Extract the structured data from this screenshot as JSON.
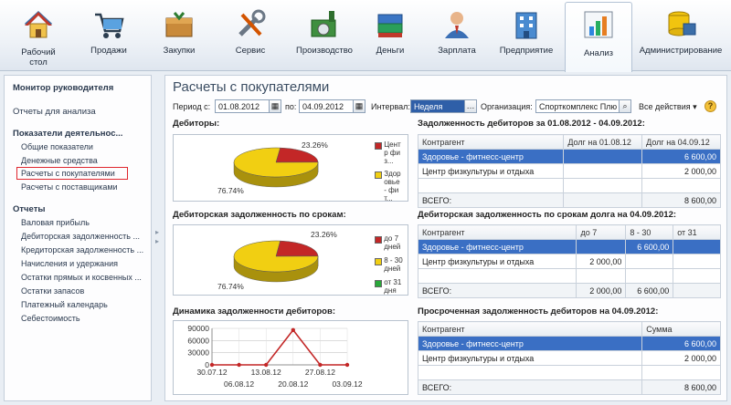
{
  "sections": [
    {
      "label": "Рабочий\nстол",
      "icon": "home-icon"
    },
    {
      "label": "Продажи",
      "icon": "sales-icon"
    },
    {
      "label": "Закупки",
      "icon": "purchases-icon"
    },
    {
      "label": "Сервис",
      "icon": "service-icon"
    },
    {
      "label": "Производство",
      "icon": "production-icon"
    },
    {
      "label": "Деньги",
      "icon": "money-icon"
    },
    {
      "label": "Зарплата",
      "icon": "salary-icon"
    },
    {
      "label": "Предприятие",
      "icon": "enterprise-icon"
    },
    {
      "label": "Анализ",
      "icon": "analysis-icon"
    },
    {
      "label": "Администрирование",
      "icon": "admin-icon"
    }
  ],
  "nav": {
    "monitor": "Монитор руководителя",
    "reports_for_analysis": "Отчеты для анализа",
    "indicators_header": "Показатели деятельнос...",
    "indicators": [
      "Общие показатели",
      "Денежные средства",
      "Расчеты с покупателями",
      "Расчеты с поставщиками"
    ],
    "reports_header": "Отчеты",
    "reports": [
      "Валовая прибыль",
      "Дебиторская задолженность ...",
      "Кредиторская задолженность ...",
      "Начисления и удержания",
      "Остатки прямых и косвенных ...",
      "Остатки запасов",
      "Платежный календарь",
      "Себестоимость"
    ]
  },
  "main": {
    "title": "Расчеты с покупателями",
    "period_from_label": "Период с:",
    "period_from": "01.08.2012",
    "period_to_label": "по:",
    "period_to": "04.09.2012",
    "interval_label": "Интервал:",
    "interval": "Неделя",
    "org_label": "Организация:",
    "org": "Спорткомплекс Плю",
    "all_actions": "Все действия",
    "help": "?"
  },
  "debtors_block": {
    "title": "Дебиторы:",
    "legend": [
      "Центр физ...",
      "Здоровье - фит..."
    ],
    "labels": {
      "small": "23.26%",
      "large": "76.74%"
    }
  },
  "debt_by_term_block": {
    "title": "Дебиторская задолженность по срокам:",
    "legend": [
      "до 7 дней",
      "8 - 30 дней",
      "от 31 дня"
    ],
    "labels": {
      "small": "23.26%",
      "large": "76.74%"
    }
  },
  "dynamics_block": {
    "title": "Динамика задолженности дебиторов:"
  },
  "chart_data": [
    {
      "type": "pie",
      "title": "Дебиторы:",
      "categories": [
        "Центр физ...",
        "Здоровье - фит..."
      ],
      "values": [
        23.26,
        76.74
      ],
      "colors": [
        "#c32727",
        "#f1cf12"
      ],
      "legend": "right"
    },
    {
      "type": "pie",
      "title": "Дебиторская задолженность по срокам:",
      "categories": [
        "до 7 дней",
        "8 - 30 дней",
        "от 31 дня"
      ],
      "values": [
        23.26,
        76.74,
        0
      ],
      "colors": [
        "#c32727",
        "#f1cf12",
        "#29a83a"
      ],
      "legend": "right"
    },
    {
      "type": "line",
      "title": "Динамика задолженности дебиторов:",
      "x": [
        "30.07.12",
        "06.08.12",
        "13.08.12",
        "20.08.12",
        "27.08.12",
        "03.09.12"
      ],
      "y": [
        0,
        0,
        0,
        86000,
        0,
        0
      ],
      "ylim": [
        0,
        90000
      ],
      "yticks": [
        "90000",
        "60000",
        "30000",
        "0"
      ],
      "color": "#c32727",
      "grid": true
    }
  ],
  "table_debt": {
    "title": "Задолженность дебиторов за 01.08.2012 - 04.09.2012:",
    "headers": [
      "Контрагент",
      "Долг на 01.08.12",
      "Долг на 04.09.12"
    ],
    "rows": [
      [
        "Здоровье - фитнесс-центр",
        "",
        "6 600,00"
      ],
      [
        "Центр физкультуры и отдыха",
        "",
        "2 000,00"
      ]
    ],
    "total": [
      "ВСЕГО:",
      "",
      "8 600,00"
    ]
  },
  "table_terms": {
    "title": "Дебиторская задолженность по срокам долга на 04.09.2012:",
    "headers": [
      "Контрагент",
      "до 7",
      "8 - 30",
      "от 31"
    ],
    "rows": [
      [
        "Здоровье - фитнесс-центр",
        "",
        "6 600,00",
        ""
      ],
      [
        "Центр физкультуры и отдыха",
        "2 000,00",
        "",
        ""
      ]
    ],
    "total": [
      "ВСЕГО:",
      "2 000,00",
      "6 600,00",
      ""
    ]
  },
  "table_overdue": {
    "title": "Просроченная задолженность дебиторов на 04.09.2012:",
    "headers": [
      "Контрагент",
      "Сумма"
    ],
    "rows": [
      [
        "Здоровье - фитнесс-центр",
        "6 600,00"
      ],
      [
        "Центр физкультуры и отдыха",
        "2 000,00"
      ]
    ],
    "total": [
      "ВСЕГО:",
      "8 600,00"
    ]
  }
}
